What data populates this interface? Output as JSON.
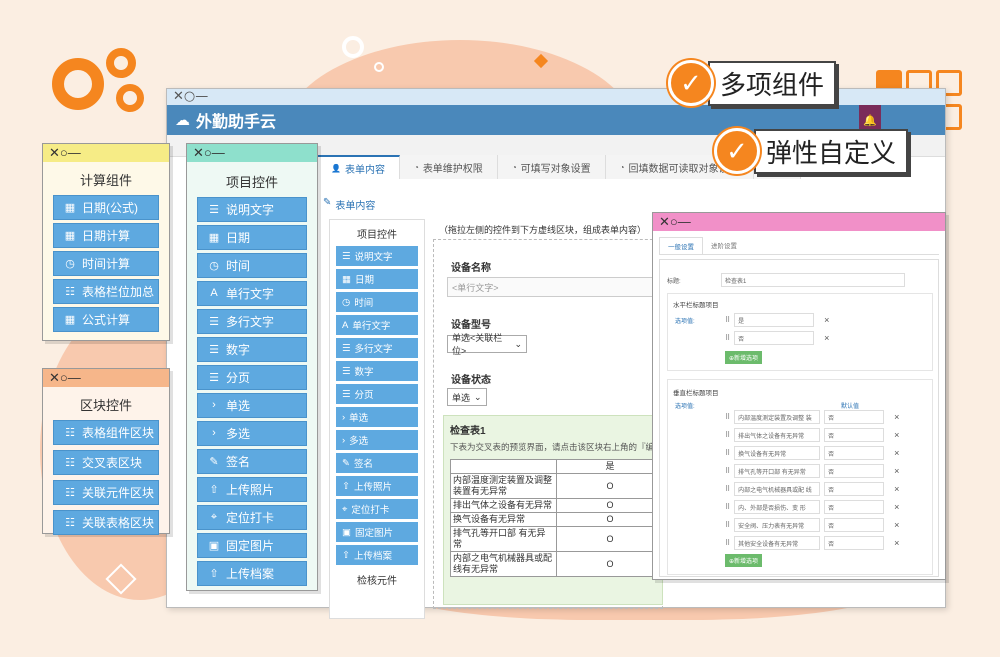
{
  "app": {
    "brand": "外勤助手云",
    "logo_icon": "cloud-logo-icon"
  },
  "window_controls": "✕○—",
  "tabs": [
    {
      "label": "表单内容",
      "icon": "user-icon",
      "active": true
    },
    {
      "label": "表单维护权限",
      "icon": "rss-icon"
    },
    {
      "label": "可填写对象设置",
      "icon": "rss-icon"
    },
    {
      "label": "回填数据可读取对象设置",
      "icon": "rss-icon"
    },
    {
      "label": "设",
      "icon": "rss-icon"
    }
  ],
  "section_title": "表单内容",
  "sidebar": {
    "title": "项目控件",
    "items": [
      "说明文字",
      "日期",
      "时间",
      "单行文字",
      "多行文字",
      "数字",
      "分页",
      "单选",
      "多选",
      "签名",
      "上传照片",
      "定位打卡",
      "固定图片",
      "上传档案"
    ],
    "footer": "检核元件"
  },
  "canvas": {
    "hint": "（拖拉左侧的控件到下方虚线区块，组成表单内容）",
    "fields": [
      {
        "label": "设备名称",
        "placeholder": "<单行文字>"
      },
      {
        "label": "设备型号",
        "value": "单选<关联栏位>"
      },
      {
        "label": "设备状态",
        "value": "单选"
      }
    ],
    "table": {
      "title": "检查表1",
      "desc": "下表为交叉表的预览界面，请点击该区块右上角的『编",
      "header": "是",
      "rows": [
        "内部温度测定装置及调整装置有无异常",
        "排出气体之设备有无异常",
        "换气设备有无异常",
        "排气孔等开口部 有无异常",
        "内部之电气机械器具或配线有无异常"
      ],
      "mark": "O"
    }
  },
  "calc_panel": {
    "title": "计算组件",
    "items": [
      "日期(公式)",
      "日期计算",
      "时间计算",
      "表格栏位加总",
      "公式计算"
    ]
  },
  "item_panel": {
    "title": "项目控件",
    "items": [
      "说明文字",
      "日期",
      "时间",
      "单行文字",
      "多行文字",
      "数字",
      "分页",
      "单选",
      "多选",
      "签名",
      "上传照片",
      "定位打卡",
      "固定图片",
      "上传档案"
    ]
  },
  "block_panel": {
    "title": "区块控件",
    "items": [
      "表格组件区块",
      "交叉表区块",
      "关联元件区块",
      "关联表格区块"
    ]
  },
  "right_panel": {
    "tabs": [
      "一般设置",
      "进阶设置"
    ],
    "title_label": "标题:",
    "title_value": "检查表1",
    "h_section": "水平栏标题项目",
    "options_label": "选项值:",
    "h_options": [
      "是",
      "否"
    ],
    "add_label": "新增选项",
    "v_section": "垂直栏标题项目",
    "default_label": "默认值",
    "v_options": [
      "内部温度测定装置及调整 装",
      "排出气体之设备有无异常",
      "换气设备有无异常",
      "排气孔等开口部 有无异常",
      "内部之电气机械器具或配 线",
      "内、外部是否损伤、变 形",
      "安全阀、压力表有无异常",
      "其他安全设备有无异常"
    ],
    "v_default": "否"
  },
  "callouts": [
    "多项组件",
    "弹性自定义"
  ],
  "colors": {
    "accent": "#f5861f",
    "header": "#4a88bb",
    "button": "#5ea9e0",
    "calc_bar": "#f6ec86",
    "item_bar": "#8ee0cc",
    "block_bar": "#f6b68a",
    "right_bar": "#f190c8"
  }
}
